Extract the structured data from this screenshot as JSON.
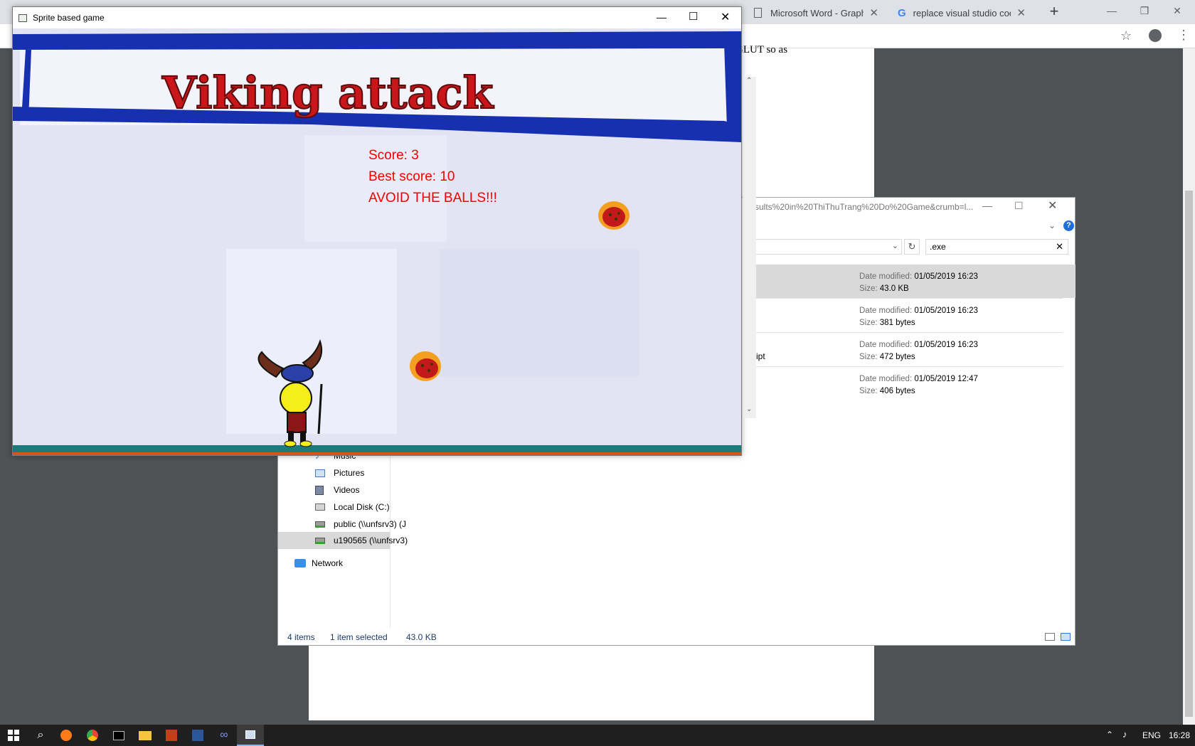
{
  "chrome": {
    "tabs": [
      {
        "title": "Microsoft Word - Graphics"
      },
      {
        "title": "replace visual studio coe -"
      }
    ],
    "new_tab": "+",
    "doc_fragment": "GLUT so as"
  },
  "explorer": {
    "address": "sults%20in%20ThiThuTrang%20Do%20Game&crumb=l...",
    "search_value": ".exe",
    "nav": [
      "Music",
      "Pictures",
      "Videos",
      "Local Disk (C:)",
      "public (\\\\unfsrv3) (J",
      "u190565 (\\\\unfsrv3)",
      "Network"
    ],
    "files": [
      {
        "date_label": "Date modified:",
        "date": "01/05/2019 16:23",
        "size_label": "Size:",
        "size": "43.0 KB"
      },
      {
        "date_label": "Date modified:",
        "date": "01/05/2019 16:23",
        "size_label": "Size:",
        "size": "381 bytes"
      },
      {
        "date_label": "Date modified:",
        "date": "01/05/2019 16:23",
        "size_label": "Size:",
        "size": "472 bytes"
      },
      {
        "date_label": "Date modified:",
        "date": "01/05/2019 12:47",
        "size_label": "Size:",
        "size": "406 bytes"
      }
    ],
    "row3_fragment": "ipt",
    "status": {
      "count": "4 items",
      "selected": "1 item selected",
      "size": "43.0 KB"
    }
  },
  "game": {
    "window_title": "Sprite based game",
    "banner_text": "Viking attack",
    "score": "Score: 3",
    "best": "Best score: 10",
    "warning": "AVOID THE BALLS!!!"
  },
  "taskbar": {
    "lang": "ENG",
    "time": "16:28"
  },
  "colors": {
    "hud": "#f20000",
    "banner": "#1630b0",
    "taskbar": "#1f1f1f"
  }
}
